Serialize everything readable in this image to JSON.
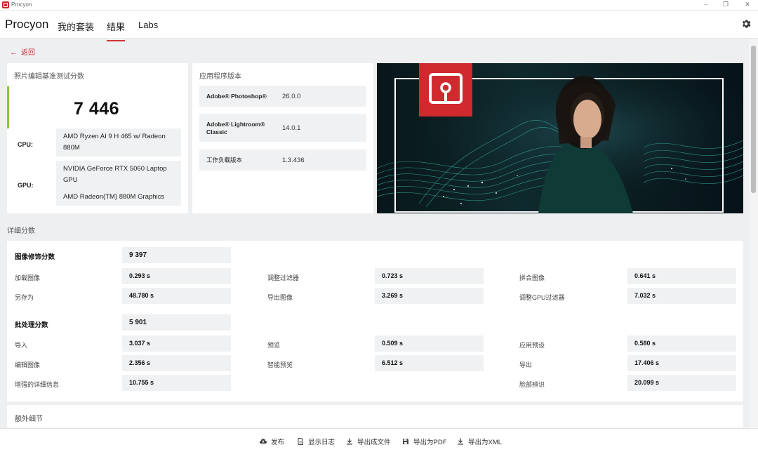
{
  "window": {
    "title": "Procyon"
  },
  "header": {
    "brand": "Procyon",
    "tabs": [
      {
        "label": "我的套装"
      },
      {
        "label": "结果"
      },
      {
        "label": "Labs"
      }
    ]
  },
  "back": {
    "label": "返回"
  },
  "score_card": {
    "title": "照片编辑基准测试分数",
    "score": "7 446",
    "cpu_label": "CPU:",
    "cpu_value": "AMD Ryzen AI 9 H 465 w/ Radeon 880M",
    "gpu_label": "GPU:",
    "gpu_values": [
      "NVIDIA GeForce RTX 5060 Laptop GPU",
      "AMD Radeon(TM) 880M Graphics"
    ]
  },
  "app_card": {
    "title": "应用程序版本",
    "rows": [
      {
        "name": "Adobe® Photoshop®",
        "version": "26.0.0"
      },
      {
        "name": "Adobe® Lightroom® Classic",
        "version": "14.0.1"
      },
      {
        "name": "工作负载版本",
        "version": "1.3.436"
      }
    ]
  },
  "details": {
    "title": "详细分数",
    "retouch": {
      "label": "图像修饰分数",
      "score": "9 397",
      "items": [
        {
          "label": "加载图像",
          "value": "0.293 s"
        },
        {
          "label": "调整过滤器",
          "value": "0.723 s"
        },
        {
          "label": "拼合图像",
          "value": "0.641 s"
        },
        {
          "label": "另存为",
          "value": "48.780 s"
        },
        {
          "label": "导出图像",
          "value": "3.269 s"
        },
        {
          "label": "调整GPU过滤器",
          "value": "7.032 s"
        }
      ]
    },
    "batch": {
      "label": "批处理分数",
      "score": "5 901",
      "items": [
        {
          "label": "导入",
          "value": "3.037 s"
        },
        {
          "label": "预览",
          "value": "0.509 s"
        },
        {
          "label": "应用预设",
          "value": "0.580 s"
        },
        {
          "label": "编辑图像",
          "value": "2.356 s"
        },
        {
          "label": "智能预览",
          "value": "6.512 s"
        },
        {
          "label": "导出",
          "value": "17.406 s"
        },
        {
          "label": "增强的详细信息",
          "value": "10.755 s"
        },
        {
          "label": "脸部辨识",
          "value": "20.099 s"
        }
      ]
    }
  },
  "extra": {
    "title": "额外细节"
  },
  "footer": {
    "publish": "发布",
    "show_log": "显示日志",
    "export_file": "导出成文件",
    "export_pdf": "导出为PDF",
    "export_xml": "导出为XML"
  },
  "colors": {
    "accent": "#d0343a",
    "score_bar": "#8dc63f",
    "brand_red": "#d02a2e"
  }
}
